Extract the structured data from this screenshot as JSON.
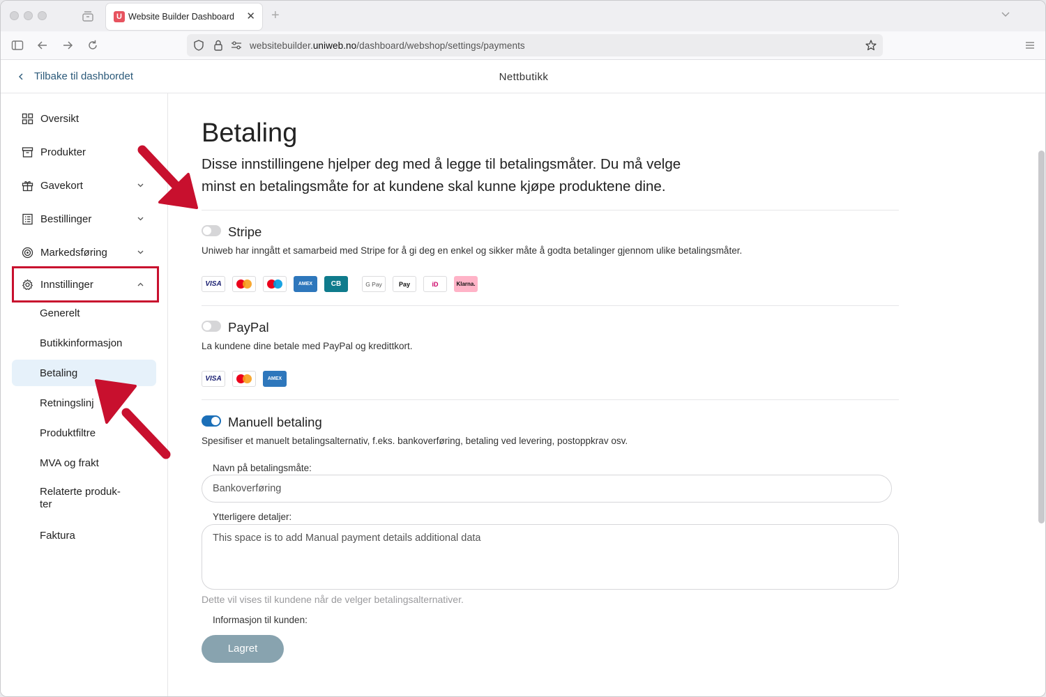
{
  "browser": {
    "tab_title": "Website Builder Dashboard",
    "tab_favicon_letter": "U",
    "tab_close_glyph": "✕",
    "tab_new_glyph": "+",
    "url_prefix": "websitebuilder.",
    "url_host": "uniweb.no",
    "url_path": "/dashboard/webshop/settings/payments"
  },
  "header": {
    "back_label": "Tilbake til dashbordet",
    "title": "Nettbutikk"
  },
  "sidebar": {
    "items": [
      {
        "label": "Oversikt",
        "icon": "grid-icon"
      },
      {
        "label": "Produkter",
        "icon": "box-icon"
      },
      {
        "label": "Gavekort",
        "icon": "gift-icon"
      },
      {
        "label": "Bestillinger",
        "icon": "list-icon"
      },
      {
        "label": "Markedsføring",
        "icon": "target-icon"
      },
      {
        "label": "Innstillinger",
        "icon": "gear-icon"
      }
    ],
    "sub_items": [
      "Generelt",
      "Butikkinformasjon",
      "Betaling",
      "Retningslinj",
      "Produktfiltre",
      "MVA og frakt",
      "Relaterte produk-",
      "ter",
      "Faktura"
    ],
    "active_sub_item": "Betaling"
  },
  "main": {
    "title": "Betaling",
    "description_line1": "Disse innstillingene hjelper deg med å legge til betalingsmåter. Du må velge",
    "description_line2": "minst en betalingsmåte for at kundene skal kunne kjøpe produktene dine.",
    "stripe": {
      "title": "Stripe",
      "enabled": false,
      "description": "Uniweb har inngått et samarbeid med Stripe for å gi deg en enkel og sikker måte å godta betalinger gjennom ulike betalingsmåter.",
      "cards": {
        "visa": "VISA",
        "amex": "AMEX",
        "cb": "CB",
        "gpay": "G Pay",
        "apay": " Pay",
        "ideal": "iD",
        "klarna": "Klarna."
      }
    },
    "paypal": {
      "title": "PayPal",
      "enabled": false,
      "description": "La kundene dine betale med PayPal og kredittkort.",
      "cards": {
        "visa": "VISA",
        "amex": "AMEX"
      }
    },
    "manual": {
      "title": "Manuell betaling",
      "enabled": true,
      "description": "Spesifiser et manuelt betalingsalternativ, f.eks. bankoverføring, betaling ved levering, postoppkrav osv.",
      "name_label": "Navn på betalingsmåte:",
      "name_value": "Bankoverføring",
      "details_label": "Ytterligere detaljer:",
      "details_value": "This space is to add Manual payment details additional data",
      "hint": "Dette vil vises til kundene når de velger betalingsalternativer.",
      "info_label": "Informasjon til kunden:",
      "save_label": "Lagret"
    }
  },
  "colors": {
    "accent": "#1b6fb8",
    "annotation_red": "#c8102e",
    "active_bg": "#e6f1fa",
    "save_button": "#88a3af",
    "mastercard_red": "#eb001b",
    "mastercard_orange": "#f79e1b",
    "maestro_blue": "#0099df"
  }
}
